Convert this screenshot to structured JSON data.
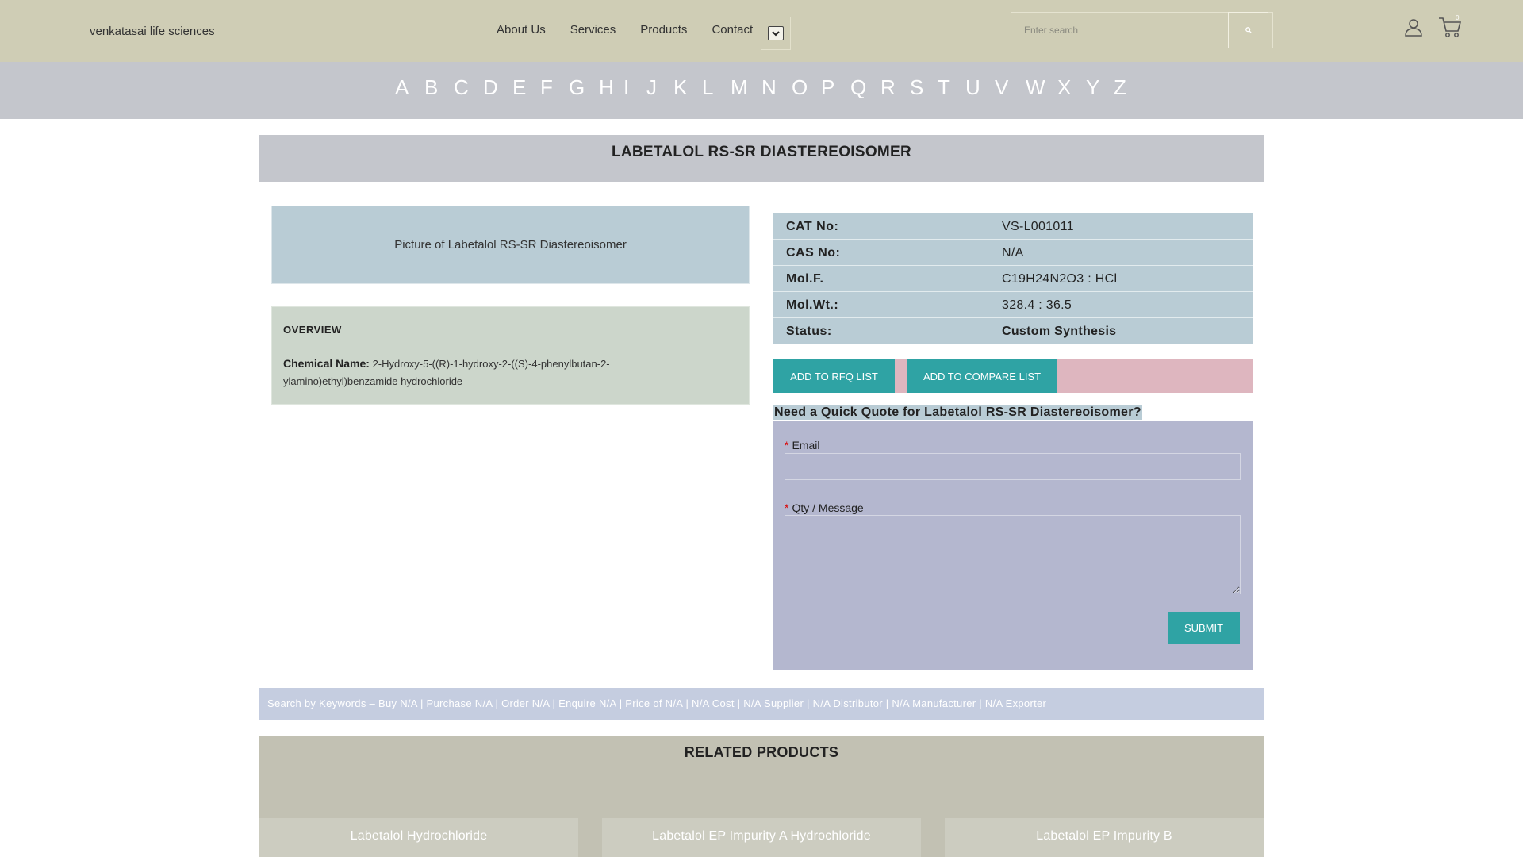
{
  "header": {
    "logo_alt": "venkatasai life sciences",
    "nav": [
      "About Us",
      "Services",
      "Products",
      "Contact"
    ],
    "search_placeholder": "Enter search",
    "cart_count": "0"
  },
  "alphabet": [
    "A",
    "B",
    "C",
    "D",
    "E",
    "F",
    "G",
    "H",
    "I",
    "J",
    "K",
    "L",
    "M",
    "N",
    "O",
    "P",
    "Q",
    "R",
    "S",
    "T",
    "U",
    "V",
    "W",
    "X",
    "Y",
    "Z"
  ],
  "product": {
    "title": "LABETALOL RS-SR DIASTEREOISOMER",
    "image_alt": "Picture of Labetalol RS-SR Diastereoisomer",
    "overview_heading": "OVERVIEW",
    "overview_toggle": "",
    "chemical_name_label": "Chemical Name:",
    "chemical_name": "2-Hydroxy-5-((R)-1-hydroxy-2-((S)-4-phenylbutan-2-ylamino)ethyl)benzamide hydrochloride",
    "specs": [
      {
        "key": "CAT No:",
        "value": "VS-L001011"
      },
      {
        "key": "CAS No:",
        "value": "N/A"
      },
      {
        "key": "Mol.F.",
        "value": "C19H24N2O3 : HCl"
      },
      {
        "key": "Mol.Wt.:",
        "value": "328.4 : 36.5"
      },
      {
        "key": "Status:",
        "value": "Custom Synthesis"
      }
    ]
  },
  "actions": {
    "rfq": "ADD TO RFQ LIST",
    "compare": "ADD TO COMPARE LIST"
  },
  "quote": {
    "title": "Need a Quick Quote for Labetalol RS-SR Diastereoisomer?",
    "required_mark": "*",
    "email_label": "Email",
    "message_label": "Qty / Message",
    "submit": "SUBMIT"
  },
  "keywords": "Search by Keywords – Buy N/A | Purchase N/A | Order N/A | Enquire N/A | Price of N/A | N/A Cost | N/A Supplier | N/A Distributor | N/A Manufacturer | N/A Exporter",
  "related": {
    "heading": "RELATED PRODUCTS",
    "items": [
      "Labetalol Hydrochloride",
      "Labetalol EP Impurity A Hydrochloride",
      "Labetalol EP Impurity B"
    ]
  }
}
